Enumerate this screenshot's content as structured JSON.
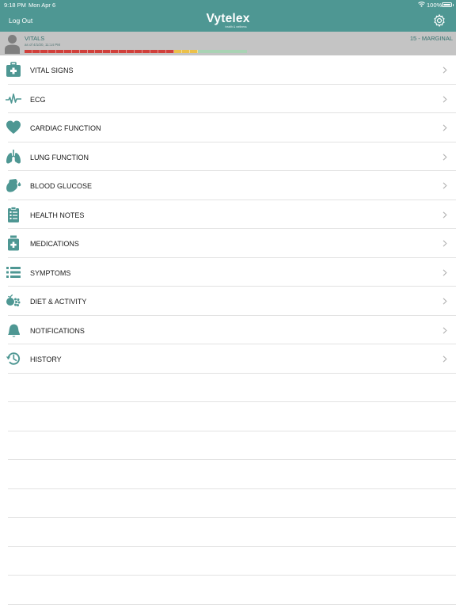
{
  "status_bar": {
    "time": "9:18 PM",
    "date": "Mon Apr 6",
    "battery": "100%"
  },
  "header": {
    "logout_label": "Log Out",
    "logo_text": "Vytelex",
    "logo_tagline": "health & wellness",
    "settings_icon": "gear-icon"
  },
  "vitals": {
    "title": "VITALS",
    "as_of": "as of 4/1/20, 11:14 PM",
    "score": "15 - MARGINAL",
    "gauge": {
      "level": 0.485,
      "red": 0.65,
      "yellow": 0.1,
      "green": 0.25
    },
    "colors": {
      "red": "#d0403b",
      "yellow": "#ecc14a",
      "green": "#a9d3b4"
    }
  },
  "menu": {
    "items": [
      {
        "label": "VITAL SIGNS",
        "icon": "medical-kit-icon"
      },
      {
        "label": "ECG",
        "icon": "heartbeat-icon"
      },
      {
        "label": "CARDIAC FUNCTION",
        "icon": "heart-icon"
      },
      {
        "label": "LUNG FUNCTION",
        "icon": "lungs-icon"
      },
      {
        "label": "BLOOD GLUCOSE",
        "icon": "glucose-icon"
      },
      {
        "label": "HEALTH NOTES",
        "icon": "clipboard-icon"
      },
      {
        "label": "MEDICATIONS",
        "icon": "medication-bottle-icon"
      },
      {
        "label": "SYMPTOMS",
        "icon": "list-icon"
      },
      {
        "label": "DIET & ACTIVITY",
        "icon": "food-icon"
      },
      {
        "label": "NOTIFICATIONS",
        "icon": "bell-icon"
      },
      {
        "label": "HISTORY",
        "icon": "history-icon"
      }
    ]
  },
  "accent_color": "#4e9793"
}
